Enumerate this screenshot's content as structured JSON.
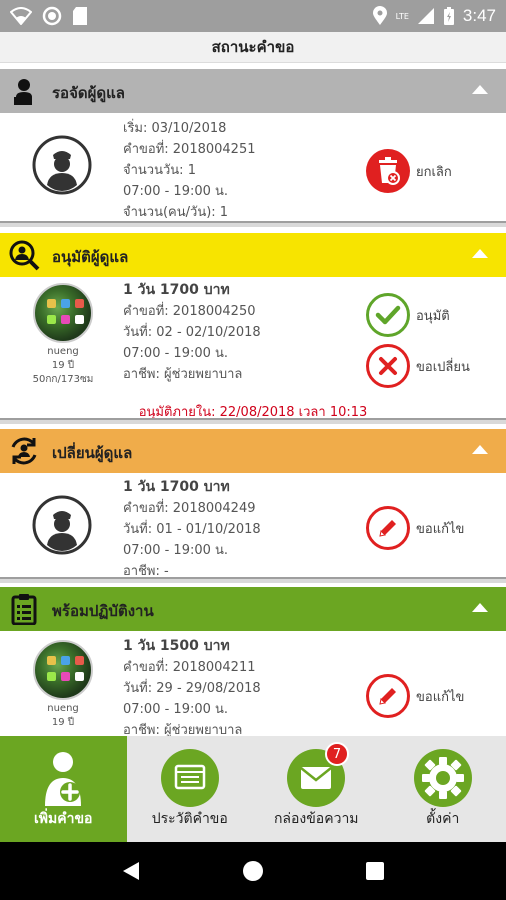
{
  "statusbar": {
    "time": "3:47",
    "network": "LTE"
  },
  "title": "สถานะคำขอ",
  "colors": {
    "pending": "#b3b3b3",
    "approve": "#f7e400",
    "change": "#f0ac4a",
    "ready": "#6ba622",
    "red": "#e02020",
    "green": "#5fa52a"
  },
  "sections": {
    "pending": {
      "title": "รอจัดผู้ดูแล",
      "icon": "caregiver-person-icon",
      "lines": [
        "เริ่ม: 03/10/2018",
        "คำขอที่: 2018004251",
        "จำนวนวัน: 1",
        "07:00 - 19:00 น.",
        "จำนวน(คน/วัน): 1"
      ],
      "actions": [
        {
          "label": "ยกเลิก",
          "icon": "trash-cancel-icon"
        }
      ]
    },
    "approve": {
      "title": "อนุมัติผู้ดูแล",
      "icon": "search-person-icon",
      "avatar": {
        "name": "nueng",
        "age": "19 ปี",
        "body": "50กก/173ซม"
      },
      "lines": [
        "1 วัน 1700 บาท",
        "คำขอที่: 2018004250",
        "วันที่: 02 - 02/10/2018",
        "07:00 - 19:00 น.",
        "อาชีพ: ผู้ช่วยพยาบาล"
      ],
      "actions": [
        {
          "label": "อนุมัติ",
          "icon": "check-icon"
        },
        {
          "label": "ขอเปลี่ยน",
          "icon": "x-icon"
        }
      ],
      "deadline": "อนุมัติภายใน: 22/08/2018 เวลา 10:13"
    },
    "change": {
      "title": "เปลี่ยนผู้ดูแล",
      "icon": "swap-person-icon",
      "lines": [
        "1 วัน 1700 บาท",
        "คำขอที่: 2018004249",
        "วันที่: 01 - 01/10/2018",
        "07:00 - 19:00 น.",
        "อาชีพ: -"
      ],
      "actions": [
        {
          "label": "ขอแก้ไข",
          "icon": "pencil-icon"
        }
      ]
    },
    "ready": {
      "title": "พร้อมปฏิบัติงาน",
      "icon": "clipboard-list-icon",
      "avatar": {
        "name": "nueng",
        "age": "19 ปี"
      },
      "lines": [
        "1 วัน 1500 บาท",
        "คำขอที่: 2018004211",
        "วันที่: 29 - 29/08/2018",
        "07:00 - 19:00 น.",
        "อาชีพ: ผู้ช่วยพยาบาล"
      ],
      "actions": [
        {
          "label": "ขอแก้ไข",
          "icon": "pencil-icon"
        }
      ]
    }
  },
  "bottomnav": [
    {
      "label": "เพิ่มคำขอ",
      "icon": "add-person-icon",
      "active": true
    },
    {
      "label": "ประวัติคำขอ",
      "icon": "history-folder-icon"
    },
    {
      "label": "กล่องข้อความ",
      "icon": "mail-icon",
      "badge": "7"
    },
    {
      "label": "ตั้งค่า",
      "icon": "gear-icon"
    }
  ]
}
